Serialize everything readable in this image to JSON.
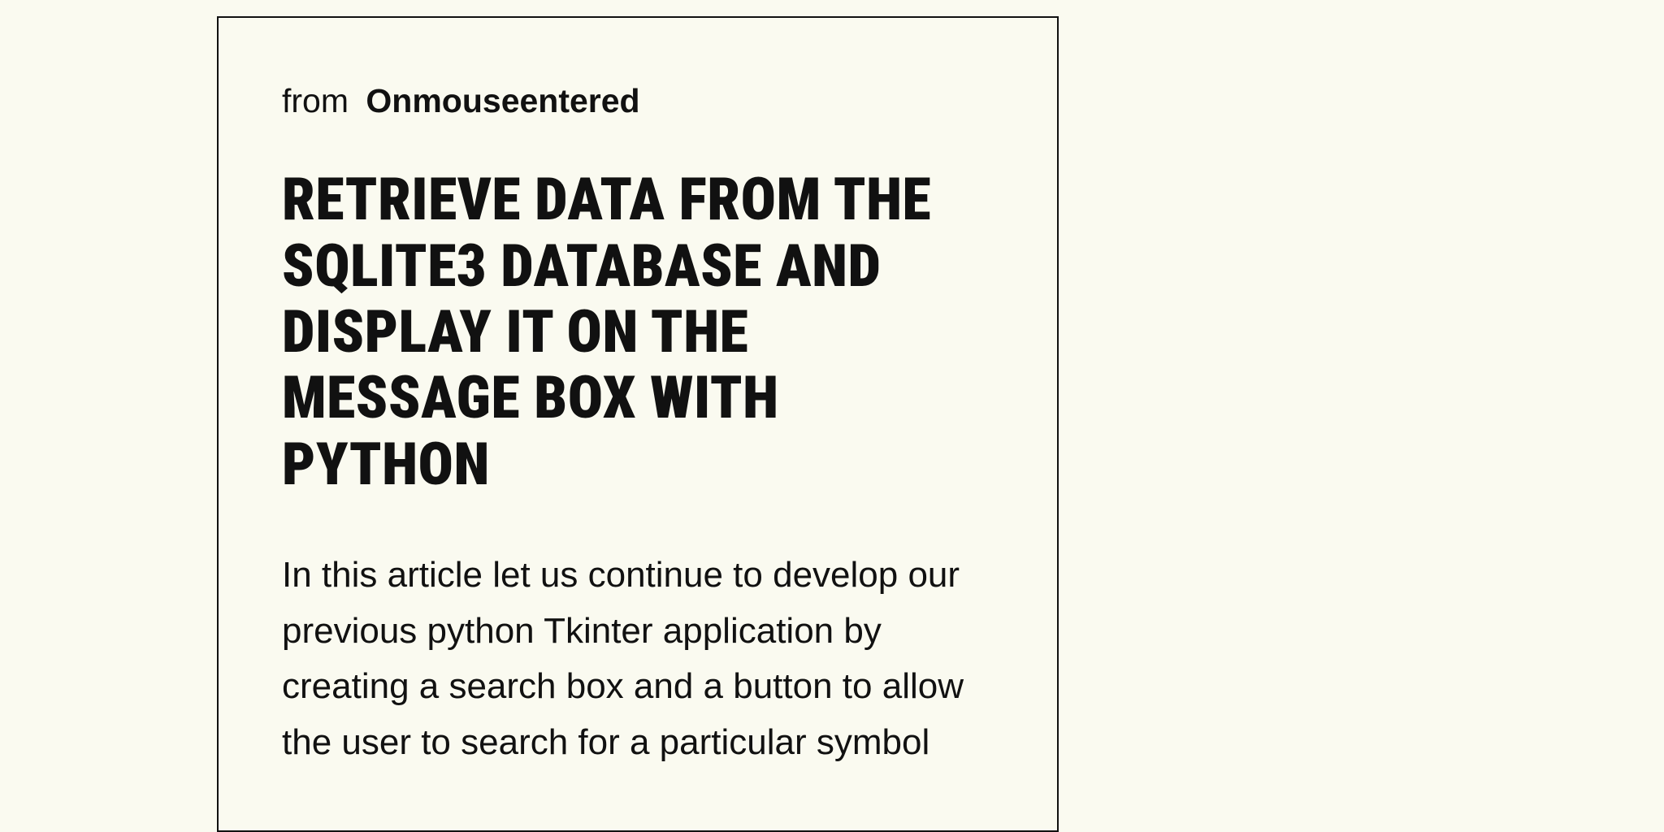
{
  "meta": {
    "from_label": "from",
    "author": "Onmouseentered"
  },
  "article": {
    "title": "RETRIEVE DATA FROM THE SQLITE3 DATABASE AND DISPLAY IT ON THE MESSAGE BOX WITH PYTHON",
    "body": "In this article let us continue to develop our previous python Tkinter application by creating a search box and a button to allow the user to search for a particular symbol"
  }
}
